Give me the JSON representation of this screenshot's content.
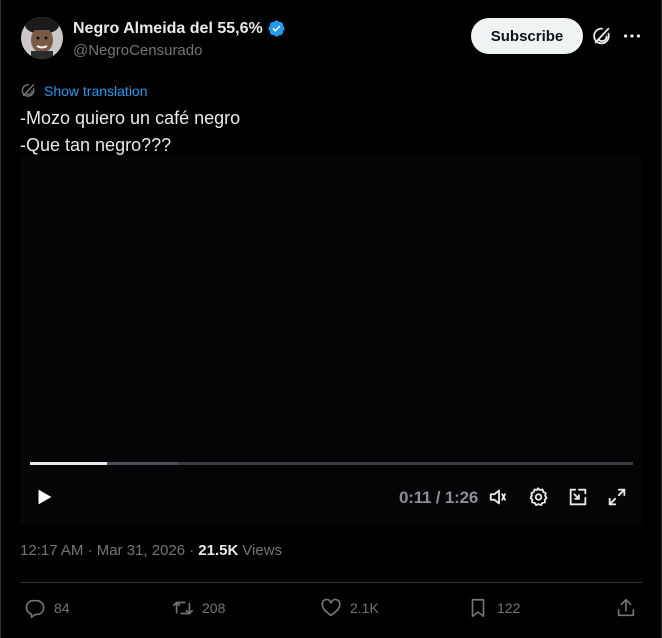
{
  "author": {
    "name": "Negro Almeida del 55,6%",
    "handle": "@NegroCensurado"
  },
  "header": {
    "subscribe_label": "Subscribe"
  },
  "translation": {
    "label": "Show translation"
  },
  "tweet": {
    "line1": "-Mozo quiero un café negro",
    "line2": "-Que tan negro???"
  },
  "video": {
    "time": "0:11 / 1:26",
    "progress_fraction": 0.128,
    "buffered_fraction": 0.245
  },
  "meta": {
    "timestamp": "12:17 AM · Mar 31, 2026 ·",
    "views_count": "21.5K",
    "views_label": "Views"
  },
  "actions": {
    "replies": "84",
    "reposts": "208",
    "likes": "2.1K",
    "bookmarks": "122"
  },
  "colors": {
    "accent": "#1d9bf0",
    "background": "#000000"
  }
}
